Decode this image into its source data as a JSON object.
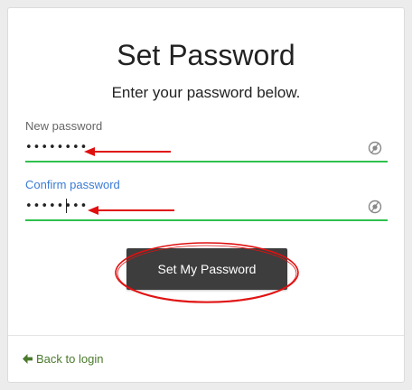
{
  "form": {
    "title": "Set Password",
    "subtitle": "Enter your password below.",
    "new_password": {
      "label": "New password",
      "value": "••••••••"
    },
    "confirm_password": {
      "label": "Confirm password",
      "value": "••••••••"
    },
    "submit_label": "Set My Password",
    "back_link_label": "Back to login"
  },
  "icons": {
    "reveal_password": "eye-icon",
    "back": "arrow-left-icon",
    "annotation_arrow": "red-arrow-icon"
  },
  "colors": {
    "accent_underline": "#2ec14e",
    "focused_label": "#3a7bd5",
    "button_bg": "#3d3d3d",
    "link": "#4a7a2c",
    "annotation": "#e01010"
  }
}
